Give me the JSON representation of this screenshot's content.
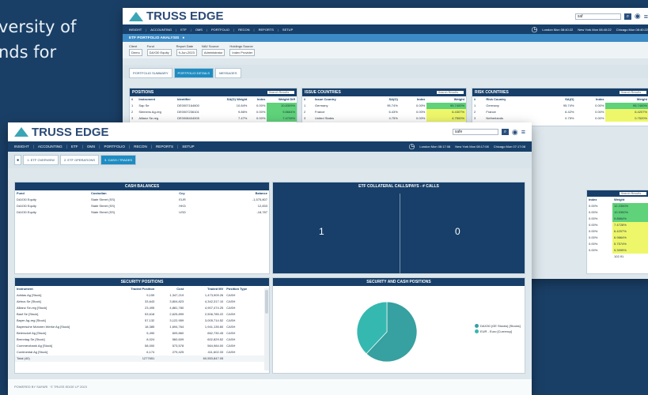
{
  "background": {
    "line1": "versity of",
    "line2": "nds for"
  },
  "back": {
    "logo": "TRUSS EDGE",
    "search": "saf",
    "nav": [
      "INSIGHT",
      "ACCOUNTING",
      "ETF",
      "OMS",
      "PORTFOLIO",
      "RECON",
      "REPORTS",
      "SETUP"
    ],
    "clocks": [
      "London Mon 08:40:22",
      "New York Mon 08:40:22",
      "Chicago Mon 08:40:22"
    ],
    "subtitle": "ETF PORTFOLIO ANALYSIS",
    "controls": {
      "client": "Demo",
      "fund": "DAX30 Equity",
      "report_date": "9-Jun-2023",
      "nav_source": "Administrator",
      "holdings_source": "Index Provider"
    },
    "labels": {
      "client": "Client",
      "fund": "Fund",
      "report_date": "Report Date",
      "nav_source": "NAV Source",
      "holdings_source": "Holdings Source"
    },
    "tabs": [
      "PORTFOLIO SUMMARY",
      "PORTFOLIO DETAILS",
      "MESSAGES"
    ],
    "positions_title": "POSITIONS",
    "issue_title": "ISSUE COUNTRIES",
    "risk_title": "RISK COUNTRIES",
    "search_placeholder": "Search Results",
    "positions": [
      [
        "1",
        "Sap Se",
        "DE0007164600",
        "10.84%",
        "0.00%",
        "10.8309%"
      ],
      [
        "2",
        "Siemens Ag-reg",
        "DE0007236101",
        "9.86%",
        "0.00%",
        "9.8664%"
      ],
      [
        "3",
        "Allianz Se-reg",
        "DE0008404005",
        "7.47%",
        "0.00%",
        "7.4728%"
      ]
    ],
    "issue": [
      [
        "1",
        "Germany",
        "95.74%",
        "0.00%",
        "95.7400%"
      ],
      [
        "2",
        "France",
        "6.43%",
        "0.00%",
        "6.4307%"
      ],
      [
        "3",
        "United States",
        "4.75%",
        "0.00%",
        "4.7500%"
      ]
    ],
    "risk": [
      [
        "1",
        "Germany",
        "95.74%",
        "0.00%",
        "95.7400%"
      ],
      [
        "2",
        "France",
        "6.42%",
        "0.00%",
        "6.4207%"
      ],
      [
        "3",
        "Netherlands",
        "0.75%",
        "0.00%",
        "0.7520%"
      ]
    ],
    "side_rows": [
      [
        "0.00%",
        "12.2300%"
      ],
      [
        "0.00%",
        "10.9300%"
      ],
      [
        "0.00%",
        "9.8664%"
      ],
      [
        "0.00%",
        "7.4728%"
      ],
      [
        "0.00%",
        "6.4207%"
      ],
      [
        "0.00%",
        "6.9864%"
      ],
      [
        "0.00%",
        "5.7574%"
      ],
      [
        "0.00%",
        "5.3999%"
      ]
    ],
    "side_total": "102.91"
  },
  "front": {
    "logo": "TRUSS EDGE",
    "search": "safe",
    "nav": [
      "INSIGHT",
      "ACCOUNTING",
      "ETF",
      "OMS",
      "PORTFOLIO",
      "RECON",
      "REPORTS",
      "SETUP"
    ],
    "clocks": [
      "London Mon 08:17:08",
      "New York Mon 08:17:08",
      "Chicago Mon 07:17:08"
    ],
    "tabs": [
      "1. ETF OVERVIEW",
      "2. ETF OPERATIONS",
      "3. CASH / TRADES"
    ],
    "cash_title": "CASH BALANCES",
    "cash_headers": [
      "Fund",
      "Custodian",
      "Ccy",
      "Balance"
    ],
    "cash_rows": [
      [
        "DAX30 Equity",
        "State Street (SS)",
        "EUR",
        "-1,575,807"
      ],
      [
        "DAX30 Equity",
        "State Street (SS)",
        "HKD",
        "12,833"
      ],
      [
        "DAX30 Equity",
        "State Street (SS)",
        "USD",
        "-18,787"
      ]
    ],
    "calls_title": "ETF COLLATERAL CALLS/PAYS - # CALLS",
    "calls": [
      "1",
      "0"
    ],
    "sec_title": "SECURITY POSITIONS",
    "sec_headers": [
      "Instrument",
      "Traded Position",
      "Cost",
      "Traded MV",
      "Position Type"
    ],
    "sec_rows": [
      [
        "Adidas Ag [Stock]",
        "9,159",
        "1,347,219",
        "1,473,909.26",
        "CASH"
      ],
      [
        "Airbus Se [Stock]",
        "33,643",
        "3,804,823",
        "4,342,317.10",
        "CASH"
      ],
      [
        "Allianz Se-reg [Stock]",
        "23,495",
        "4,881,780",
        "4,907,474.25",
        "CASH"
      ],
      [
        "Basf Se [Stock]",
        "53,618",
        "2,625,899",
        "2,506,785.22",
        "CASH"
      ],
      [
        "Bayer Ag-reg [Stock]",
        "57,132",
        "3,122,959",
        "3,005,714.52",
        "CASH"
      ],
      [
        "Bayerische Motoren Werke Ag [Stock]",
        "18,385",
        "1,694,764",
        "1,941,135.60",
        "CASH"
      ],
      [
        "Beiersdorf Ag [Stock]",
        "5,490",
        "609,860",
        "662,730.45",
        "CASH"
      ],
      [
        "Brenntag Se [Stock]",
        "8,024",
        "560,609",
        "602,829.52",
        "CASH"
      ],
      [
        "Commerzbank Ag [Stock]",
        "58,000",
        "573,578",
        "564,984.00",
        "CASH"
      ],
      [
        "Continental Ag [Stock]",
        "6,174",
        "279,425",
        "411,602.33",
        "CASH"
      ]
    ],
    "sec_total": [
      "Total (40)",
      "1277651",
      "",
      "60,553,847.05",
      ""
    ],
    "pie_title": "SECURITY AND CASH POSITIONS",
    "chart_data": {
      "type": "pie",
      "categories": [
        "DAX30 (GE Stocks) [Stocks]",
        "EUR - Euro [Currency]"
      ],
      "values": [
        62,
        38
      ],
      "colors": [
        "#37a0a0",
        "#35b8b0"
      ]
    },
    "footer": "POWERED BY SAFARI · © TRUSS EDGE LP 2023"
  }
}
